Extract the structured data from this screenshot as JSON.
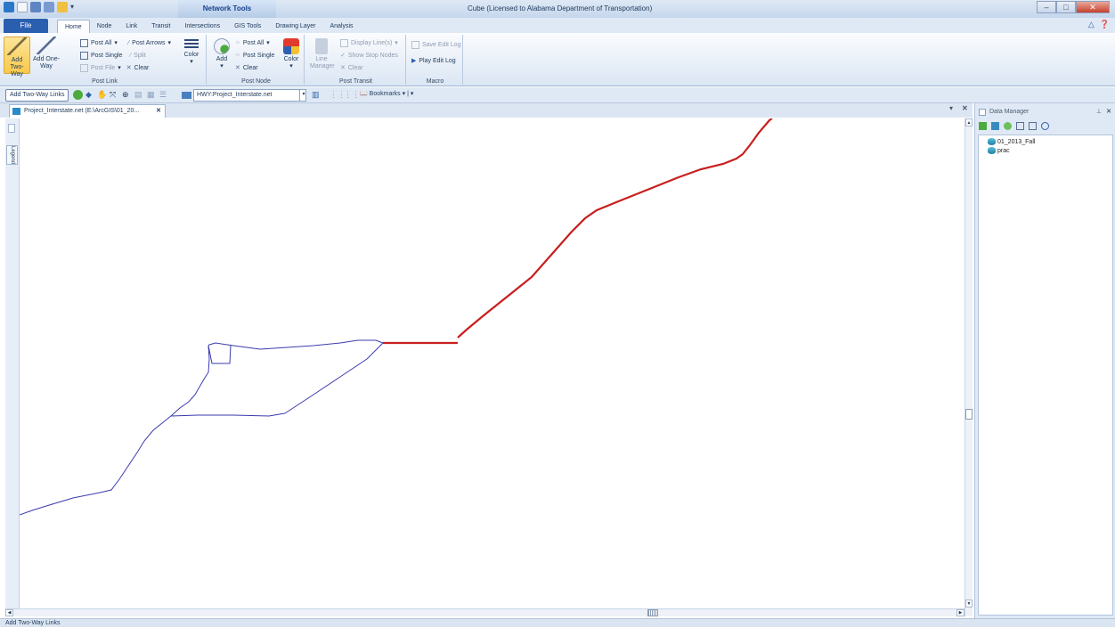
{
  "window": {
    "title": "Cube (Licensed to Alabama Department of Transportation)",
    "context_tab": "Network Tools"
  },
  "ribbon": {
    "file_label": "File",
    "tabs": [
      "Home",
      "Node",
      "Link",
      "Transit",
      "Intersections",
      "GIS Tools",
      "Drawing Layer",
      "Analysis"
    ],
    "active_tab": "Home",
    "post_link": {
      "label": "Post Link",
      "add_two_way": "Add Two-Way",
      "add_one_way": "Add One-Way",
      "post_all": "Post All",
      "post_single": "Post Single",
      "post_file": "Post File",
      "post_arrows": "Post Arrows",
      "split": "Split",
      "clear": "Clear",
      "color": "Color"
    },
    "post_node": {
      "label": "Post Node",
      "add": "Add",
      "post_all": "Post All",
      "post_single": "Post Single",
      "clear": "Clear",
      "color": "Color"
    },
    "post_transit": {
      "label": "Post Transit",
      "line_manager": "Line Manager",
      "display_lines": "Display Line(s)",
      "show_stop_nodes": "Show Stop Nodes",
      "clear": "Clear"
    },
    "macro": {
      "label": "Macro",
      "save_edit_log": "Save Edit Log",
      "play_edit_log": "Play Edit Log"
    }
  },
  "toolbar": {
    "active_tool": "Add Two-Way Links",
    "layer_combo": "HWY:Project_Interstate.net",
    "bookmarks": "Bookmarks"
  },
  "document": {
    "tab_label": "Project_Interstate.net (E:\\ArcGIS\\01_20...",
    "legend_label": "Legend"
  },
  "data_manager": {
    "title": "Data Manager",
    "items": [
      "01_2013_Fall",
      "prac"
    ]
  },
  "status": {
    "text": "Add Two-Way Links"
  },
  "colors": {
    "network_link": "#3b3bb0",
    "posted_link": "#c81e1e",
    "file_tab": "#2a5fb0"
  }
}
